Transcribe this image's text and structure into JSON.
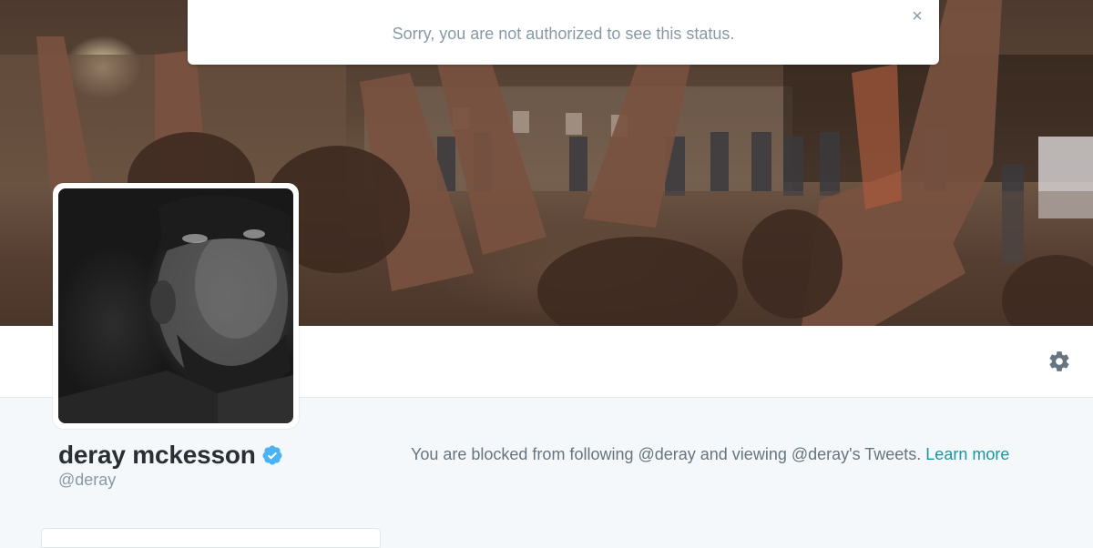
{
  "header": {
    "photo": "protest-header-photo"
  },
  "toast": {
    "message": "Sorry, you are not authorized to see this status.",
    "close_label": "×",
    "close_icon": "close-icon"
  },
  "navbar": {
    "settings_icon": "gear-icon"
  },
  "profile": {
    "name": "deray mckesson",
    "handle": "@deray",
    "verified_icon": "verified-badge-icon",
    "avatar": "profile-avatar-photo"
  },
  "blocked_notice": {
    "message": "You are blocked from following @deray and viewing @deray's Tweets.",
    "link_text": "Learn more"
  },
  "colors": {
    "accent_link": "#1b95a0",
    "verified_blue": "#4ab3f4",
    "secondary_text": "#8899a6",
    "body_text": "#66757f",
    "name_text": "#292f33"
  }
}
